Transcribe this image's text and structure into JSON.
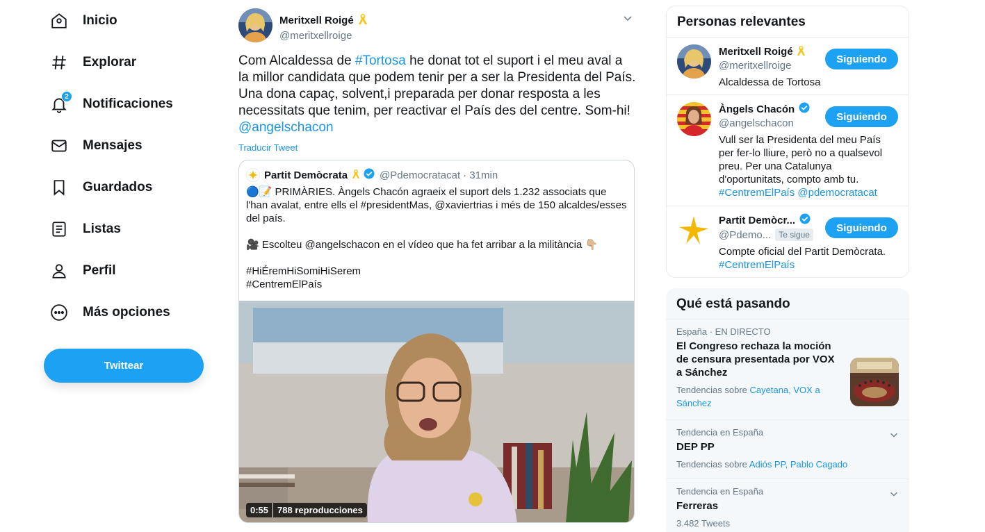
{
  "nav": {
    "items": [
      {
        "label": "Inicio",
        "icon": "home-icon"
      },
      {
        "label": "Explorar",
        "icon": "hash-icon"
      },
      {
        "label": "Notificaciones",
        "icon": "bell-icon",
        "badge": "2"
      },
      {
        "label": "Mensajes",
        "icon": "mail-icon"
      },
      {
        "label": "Guardados",
        "icon": "bookmark-icon"
      },
      {
        "label": "Listas",
        "icon": "list-icon"
      },
      {
        "label": "Perfil",
        "icon": "person-icon"
      },
      {
        "label": "Más opciones",
        "icon": "more-icon"
      }
    ],
    "tweet_button": "Twittear"
  },
  "tweet": {
    "author_name": "Meritxell Roigé",
    "author_handle": "@meritxellroige",
    "text_part1": "Com Alcaldessa de ",
    "hashtag": "#Tortosa",
    "text_part2": " he donat tot el suport i el meu aval a la millor candidata que podem tenir per a ser la Presidenta del País. Una dona capaç, solvent,i preparada per donar resposta a les necessitats que tenim, per reactivar el País des del centre. Som-hi! ",
    "mention": "@angelschacon",
    "translate": "Traducir Tweet",
    "quote": {
      "name": "Partit Demòcrata",
      "handle": "@Pdemocratacat",
      "time": "· 31min",
      "text": "🔵📝 PRIMÀRIES. Àngels Chacón agraeix el suport dels 1.232 associats que l'han avalat, entre ells el #presidentMas, @xaviertrias i més de 150 alcaldes/esses del país.\n\n🎥 Escolteu @angelschacon en el vídeo que ha fet arribar a la militància 👇🏼\n\n#HiÉremHiSomiHiSerem\n#CentremElPaís",
      "video_duration": "0:55",
      "video_views": "788 reproducciones"
    }
  },
  "relevant": {
    "title": "Personas relevantes",
    "people": [
      {
        "name": "Meritxell Roigé",
        "handle": "@meritxellroige",
        "bio": "Alcaldessa de Tortosa",
        "bio_link": "",
        "button": "Siguiendo"
      },
      {
        "name": "Àngels Chacón",
        "handle": "@angelschacon",
        "bio": "Vull ser la Presidenta del meu País per fer-lo lliure, però no a qualsevol preu. Per una Catalunya d'oportunitats, compto amb tu.",
        "bio_link": "#CentremElPaís @pdemocratacat",
        "button": "Siguiendo"
      },
      {
        "name": "Partit Demòcr...",
        "handle": "@Pdemo...",
        "follows_you": "Te sigue",
        "bio": "Compte oficial del Partit Demòcrata.",
        "bio_link": "#CentremElPaís",
        "button": "Siguiendo"
      }
    ]
  },
  "trends": {
    "title": "Qué está pasando",
    "items": [
      {
        "meta": "España · EN DIRECTO",
        "title": "El Congreso rechaza la moción de censura presentada por VOX a Sánchez",
        "sub_prefix": "Tendencias sobre ",
        "sub_links": "Cayetana, VOX a Sánchez"
      },
      {
        "meta": "Tendencia en España",
        "title": "DEP PP",
        "sub_prefix": "Tendencias sobre ",
        "sub_links": "Adiós PP, Pablo Cagado"
      },
      {
        "meta": "Tendencia en España",
        "title": "Ferreras",
        "sub_prefix": "3.482 Tweets",
        "sub_links": ""
      }
    ]
  },
  "colors": {
    "accent": "#1da1f2",
    "link": "#1b95e0",
    "text": "#14171a",
    "muted": "#657786"
  }
}
